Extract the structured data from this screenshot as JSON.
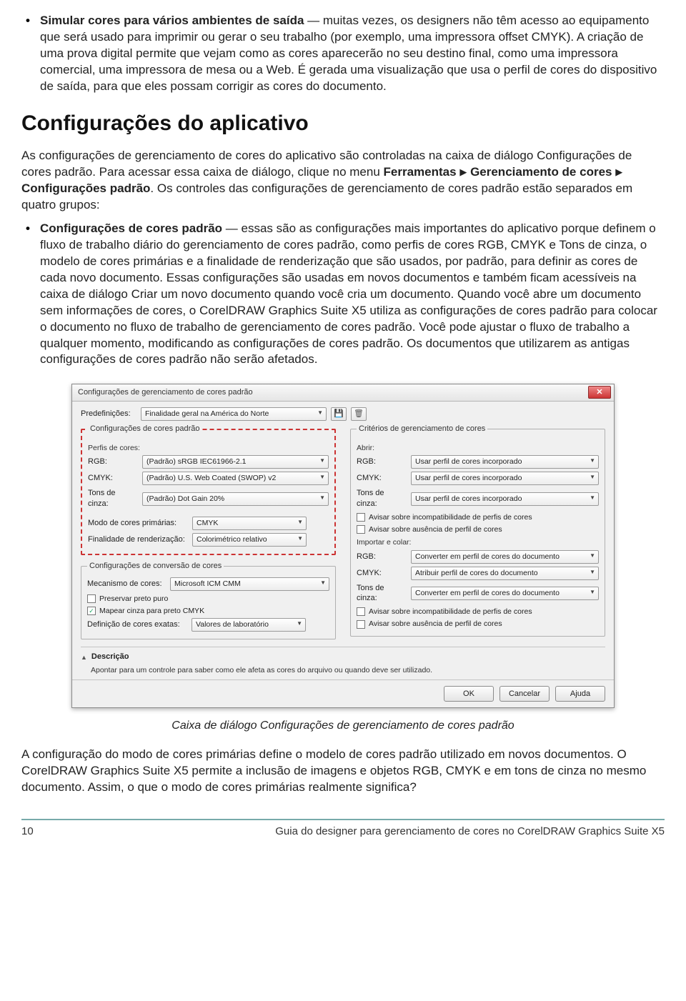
{
  "intro_bullet": {
    "title": "Simular cores para vários ambientes de saída",
    "rest": " — muitas vezes, os designers não têm acesso ao equipamento que será usado para imprimir ou gerar o seu trabalho (por exemplo, uma impressora offset CMYK). A criação de uma prova digital permite que vejam como as cores aparecerão no seu destino final, como uma impressora comercial, uma impressora de mesa ou a Web. É gerada uma visualização que usa o perfil de cores do dispositivo de saída, para que eles possam corrigir as cores do documento."
  },
  "section_title": "Configurações do aplicativo",
  "para1_a": "As configurações de gerenciamento de cores do aplicativo são controladas na caixa de diálogo Configurações de cores padrão. Para acessar essa caixa de diálogo, clique no menu ",
  "menu1": "Ferramentas",
  "menu2": "Gerenciamento de cores",
  "menu3": "Configurações padrão",
  "para1_b": ". Os controles das configurações de gerenciamento de cores padrão estão separados em quatro grupos:",
  "bullet2": {
    "title": "Configurações de cores padrão",
    "rest": " — essas são as configurações mais importantes do aplicativo porque definem o fluxo de trabalho diário do gerenciamento de cores padrão, como perfis de cores RGB, CMYK e Tons de cinza, o modelo de cores primárias e a finalidade de renderização que são usados, por padrão, para definir as cores de cada novo documento. Essas configurações são usadas em novos documentos e também ficam acessíveis na caixa de diálogo Criar um novo documento quando você cria um documento. Quando você abre um documento sem informações de cores, o CorelDRAW Graphics Suite X5 utiliza as configurações de cores padrão para colocar o documento no fluxo de trabalho de gerenciamento de cores padrão. Você pode ajustar o fluxo de trabalho a qualquer momento, modificando as configurações de cores padrão. Os documentos que utilizarem as antigas configurações de cores padrão não serão afetados."
  },
  "dialog": {
    "title": "Configurações de gerenciamento de cores padrão",
    "predef_label": "Predefinições:",
    "predef_value": "Finalidade geral na América do Norte",
    "left": {
      "legend": "Configurações de cores padrão",
      "profiles_label": "Perfis de cores:",
      "rgb_label": "RGB:",
      "rgb_value": "(Padrão) sRGB IEC61966-2.1",
      "cmyk_label": "CMYK:",
      "cmyk_value": "(Padrão) U.S. Web Coated (SWOP) v2",
      "gray_label": "Tons de cinza:",
      "gray_value": "(Padrão) Dot Gain 20%",
      "primary_label": "Modo de cores primárias:",
      "primary_value": "CMYK",
      "render_label": "Finalidade de renderização:",
      "render_value": "Colorimétrico relativo"
    },
    "conv": {
      "legend": "Configurações de conversão de cores",
      "engine_label": "Mecanismo de cores:",
      "engine_value": "Microsoft ICM CMM",
      "chk1": "Preservar preto puro",
      "chk2": "Mapear cinza para preto CMYK",
      "exact_label": "Definição de cores exatas:",
      "exact_value": "Valores de laboratório"
    },
    "right": {
      "legend": "Critérios de gerenciamento de cores",
      "open_label": "Abrir:",
      "rgb_label": "RGB:",
      "rgb_value": "Usar perfil de cores incorporado",
      "cmyk_label": "CMYK:",
      "cmyk_value": "Usar perfil de cores incorporado",
      "gray_label": "Tons de cinza:",
      "gray_value": "Usar perfil de cores incorporado",
      "warn1": "Avisar sobre incompatibilidade de perfis de cores",
      "warn2": "Avisar sobre ausência de perfil de cores",
      "import_label": "Importar e colar:",
      "imp_rgb_value": "Converter em perfil de cores do documento",
      "imp_cmyk_value": "Atribuir perfil de cores do documento",
      "imp_gray_value": "Converter em perfil de cores do documento",
      "warn3": "Avisar sobre incompatibilidade de perfis de cores",
      "warn4": "Avisar sobre ausência de perfil de cores"
    },
    "desc_title": "Descrição",
    "desc_text": "Apontar para um controle para saber como ele afeta as cores do arquivo ou quando deve ser utilizado.",
    "btn_ok": "OK",
    "btn_cancel": "Cancelar",
    "btn_help": "Ajuda"
  },
  "caption": "Caixa de diálogo Configurações de gerenciamento de cores padrão",
  "para2": "A configuração do modo de cores primárias define o modelo de cores padrão utilizado em novos documentos. O CorelDRAW Graphics Suite X5 permite a inclusão de imagens e objetos RGB, CMYK e em tons de cinza no mesmo documento. Assim, o que o modo de cores primárias realmente significa?",
  "footer_page": "10",
  "footer_text": "Guia do designer para gerenciamento de cores no CorelDRAW Graphics Suite X5"
}
